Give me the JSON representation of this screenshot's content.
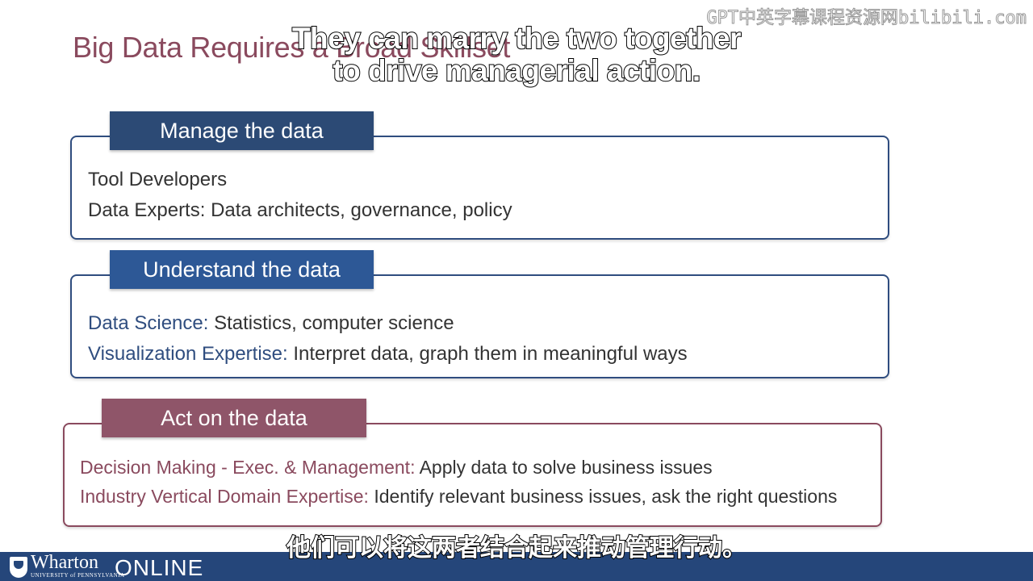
{
  "slide": {
    "title": "Big Data Requires a Broad Skillset",
    "watermark": "GPT中英字幕课程资源网bilibili.com"
  },
  "captions": {
    "english_line1": "They can marry the two together",
    "english_line2": "to drive managerial action.",
    "chinese": "他们可以将这两者结合起来推动管理行动。"
  },
  "sections": [
    {
      "header": "Manage the data",
      "lines": [
        {
          "key": "",
          "rest": "Tool Developers"
        },
        {
          "key": "",
          "rest": "Data Experts: Data architects, governance, policy"
        }
      ]
    },
    {
      "header": "Understand the data",
      "lines": [
        {
          "key": "Data Science:",
          "rest": " Statistics, computer science"
        },
        {
          "key": "Visualization Expertise:",
          "rest": " Interpret data, graph them in meaningful ways"
        }
      ]
    },
    {
      "header": "Act on the data",
      "lines": [
        {
          "key": "Decision Making - Exec. & Management:",
          "rest": " Apply data to solve business issues"
        },
        {
          "key": "Industry Vertical Domain Expertise:",
          "rest": " Identify relevant business issues, ask the right questions"
        }
      ]
    }
  ],
  "footer": {
    "logo_name": "Wharton",
    "logo_university": "UNIVERSITY of PENNSYLVANIA",
    "logo_online": "ONLINE"
  },
  "colors": {
    "title": "#8a4a5e",
    "blue_accent": "#2f4d7f",
    "maroon_accent": "#8a4a5e",
    "footer_bar": "#25467a"
  }
}
